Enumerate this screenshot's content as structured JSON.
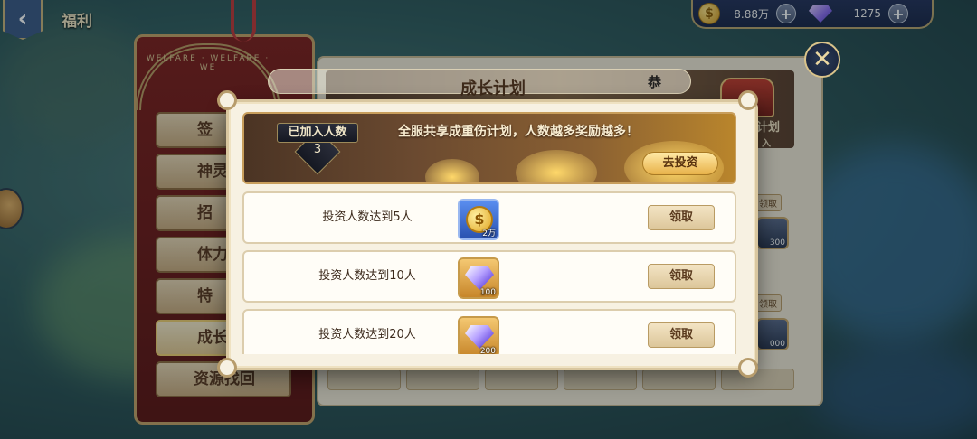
{
  "header": {
    "title": "福利",
    "back_glyph": "‹"
  },
  "currency": {
    "coins": {
      "icon": "coin-icon",
      "value": "8.88万"
    },
    "gems": {
      "icon": "gem-icon",
      "value": "1275"
    },
    "plus_glyph": "+"
  },
  "welfare": {
    "badge_text": "WELFARE · WELFARE · WE",
    "menu": [
      {
        "label": "签"
      },
      {
        "label": "神灵"
      },
      {
        "label": "招"
      },
      {
        "label": "体力"
      },
      {
        "label": "特"
      },
      {
        "label": "成长"
      },
      {
        "label": "资源找回"
      }
    ]
  },
  "background_panel": {
    "side_fragment": "计划",
    "side_sub": "入",
    "chips": [
      "领取",
      "领取",
      "领取"
    ],
    "thumb_qtys": [
      "300",
      "000"
    ]
  },
  "dialog": {
    "title": "成长计划",
    "title_right": "恭",
    "close_glyph": "✕",
    "joined_label": "已加入人数",
    "joined_count": "3",
    "banner_text": "全服共享成重伤计划，人数越多奖励越多！",
    "invest_button": "去投资",
    "rewards": [
      {
        "label": "投资人数达到5人",
        "icon": "coin-icon",
        "quantity": "2万",
        "button": "领取"
      },
      {
        "label": "投资人数达到10人",
        "icon": "gem-icon",
        "quantity": "100",
        "button": "领取"
      },
      {
        "label": "投资人数达到20人",
        "icon": "gem-icon",
        "quantity": "200",
        "button": "领取"
      }
    ]
  }
}
